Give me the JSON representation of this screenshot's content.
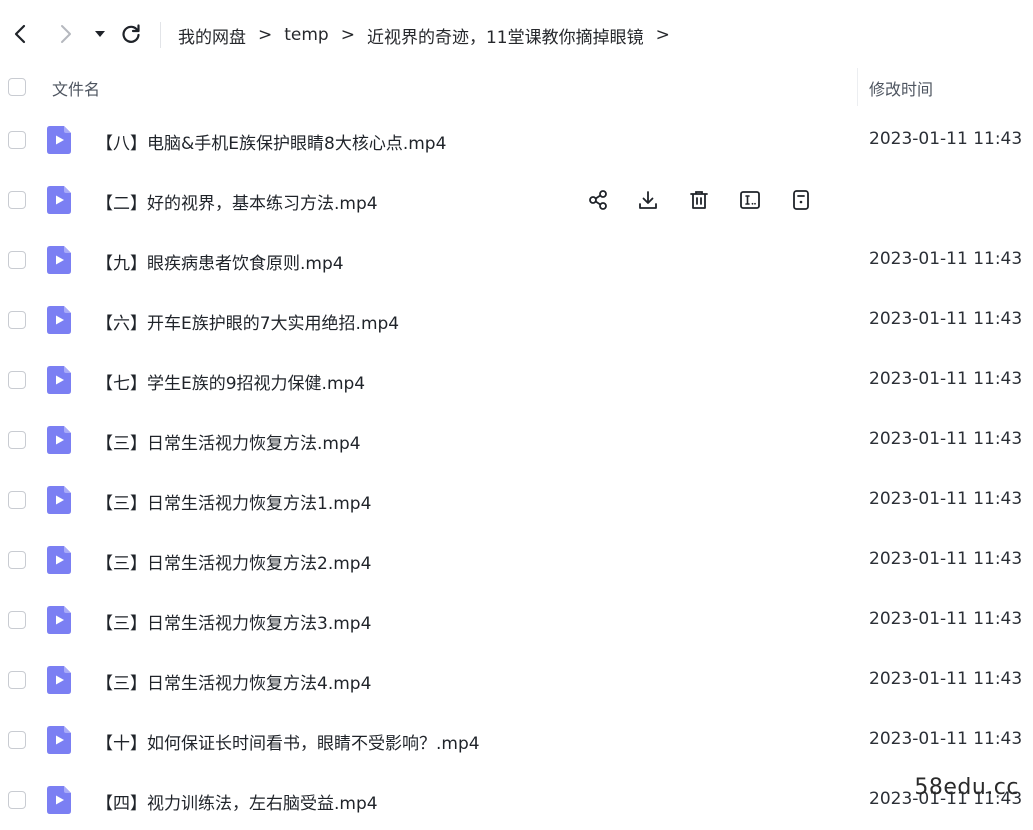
{
  "breadcrumb": {
    "items": [
      "我的网盘",
      "temp",
      "近视界的奇迹，11堂课教你摘掉眼镜"
    ],
    "separator": ">"
  },
  "header": {
    "name_label": "文件名",
    "time_label": "修改时间"
  },
  "files": [
    {
      "name": "【八】电脑&手机E族保护眼睛8大核心点.mp4",
      "time": "2023-01-11 11:43"
    },
    {
      "name": "【二】好的视界，基本练习方法.mp4",
      "time": ""
    },
    {
      "name": "【九】眼疾病患者饮食原则.mp4",
      "time": "2023-01-11 11:43"
    },
    {
      "name": "【六】开车E族护眼的7大实用绝招.mp4",
      "time": "2023-01-11 11:43"
    },
    {
      "name": "【七】学生E族的9招视力保健.mp4",
      "time": "2023-01-11 11:43"
    },
    {
      "name": "【三】日常生活视力恢复方法.mp4",
      "time": "2023-01-11 11:43"
    },
    {
      "name": "【三】日常生活视力恢复方法1.mp4",
      "time": "2023-01-11 11:43"
    },
    {
      "name": "【三】日常生活视力恢复方法2.mp4",
      "time": "2023-01-11 11:43"
    },
    {
      "name": "【三】日常生活视力恢复方法3.mp4",
      "time": "2023-01-11 11:43"
    },
    {
      "name": "【三】日常生活视力恢复方法4.mp4",
      "time": "2023-01-11 11:43"
    },
    {
      "name": "【十】如何保证长时间看书，眼睛不受影响？.mp4",
      "time": "2023-01-11 11:43"
    },
    {
      "name": "【四】视力训练法，左右脑受益.mp4",
      "time": "2023-01-11 11:43"
    }
  ],
  "hover_actions": [
    "share-icon",
    "download-icon",
    "delete-icon",
    "rename-icon",
    "detail-icon"
  ],
  "watermark": "58edu.cc",
  "colors": {
    "file_icon": "#7b7ff3",
    "checkbox_border": "#c9ccd2",
    "separator": "#e2e4e8"
  }
}
